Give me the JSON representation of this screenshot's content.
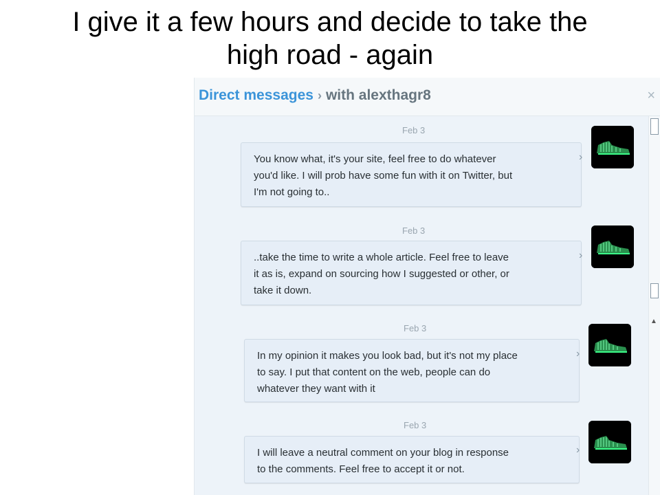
{
  "caption": {
    "line1": "I give it a few hours and decide to take the",
    "line2": "high road - again"
  },
  "header": {
    "title": "Direct messages",
    "separator": "›",
    "with_label": "with alexthagr8",
    "close_symbol": "×"
  },
  "messages": [
    {
      "date": "Feb 3",
      "lines": [
        "You know what, it's your site, feel free to do whatever",
        "you'd like. I will prob have some fun with it on Twitter, but",
        "I'm not going to.."
      ]
    },
    {
      "date": "Feb 3",
      "lines": [
        "..take the time to write a whole article.  Feel free to leave",
        "it as is, expand on sourcing how I suggested or other, or",
        "take it down."
      ]
    },
    {
      "date": "Feb 3",
      "lines": [
        "In my opinion it makes you look bad, but it's not my place",
        "to say. I put that content on the web, people can do",
        "whatever they want with it"
      ]
    },
    {
      "date": "Feb 3",
      "lines": [
        "I will leave a neutral comment on your blog in response",
        "to the comments. Feel free to accept it or not."
      ]
    }
  ],
  "colors": {
    "accent": "#3b94d9",
    "bubble": "#e6eef7",
    "panel": "#edf3f9",
    "avatar_glow": "#3cff8a"
  },
  "icons": {
    "close": "close-icon",
    "chevron": "chevron-right-icon",
    "avatar": "sneaker-avatar-icon"
  }
}
